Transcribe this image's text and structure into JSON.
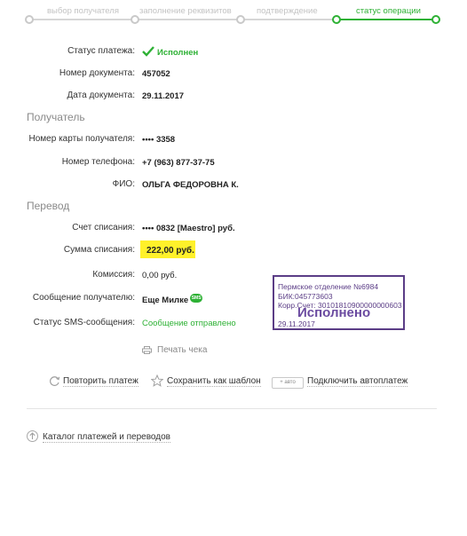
{
  "steps": [
    {
      "label": "выбор получателя"
    },
    {
      "label": "заполнение реквизитов"
    },
    {
      "label": "подтверждение"
    },
    {
      "label": "статус операции"
    }
  ],
  "payment": {
    "status_label": "Статус платежа:",
    "status_value": "Исполнен",
    "doc_num_label": "Номер документа:",
    "doc_num_value": "457052",
    "doc_date_label": "Дата документа:",
    "doc_date_value": "29.11.2017"
  },
  "recipient": {
    "section_title": "Получатель",
    "card_label": "Номер карты получателя:",
    "card_value": "•••• 3358",
    "phone_label": "Номер телефона:",
    "phone_value": "+7 (963) 877-37-75",
    "name_label": "ФИО:",
    "name_value": "ОЛЬГА ФЕДОРОВНА К."
  },
  "transfer": {
    "section_title": "Перевод",
    "account_label": "Счет списания:",
    "account_value": "•••• 0832  [Maestro]  руб.",
    "sum_label": "Сумма списания:",
    "sum_value": "222,00  руб.",
    "fee_label": "Комиссия:",
    "fee_value": "0,00 руб.",
    "message_label": "Сообщение получателю:",
    "message_value": "Еще Милке",
    "message_badge": "SMS",
    "sms_status_label": "Статус SMS-сообщения:",
    "sms_status_value": "Сообщение отправлено"
  },
  "stamp": {
    "line1": "Пермское отделение №6984",
    "line2": "БИК:045773603",
    "line3": "Корр.Счет: 30101810900000000603",
    "big": "Исполнено",
    "date": "29.11.2017"
  },
  "actions": {
    "print": "Печать чека",
    "repeat": "Повторить платеж",
    "template": "Сохранить как шаблон",
    "auto_tag": "авто",
    "autopay": "Подключить автоплатеж",
    "catalog": "Каталог платежей и переводов"
  },
  "colors": {
    "accent": "#2eb135",
    "highlight": "#fff12a",
    "stamp": "#5b3d86"
  }
}
